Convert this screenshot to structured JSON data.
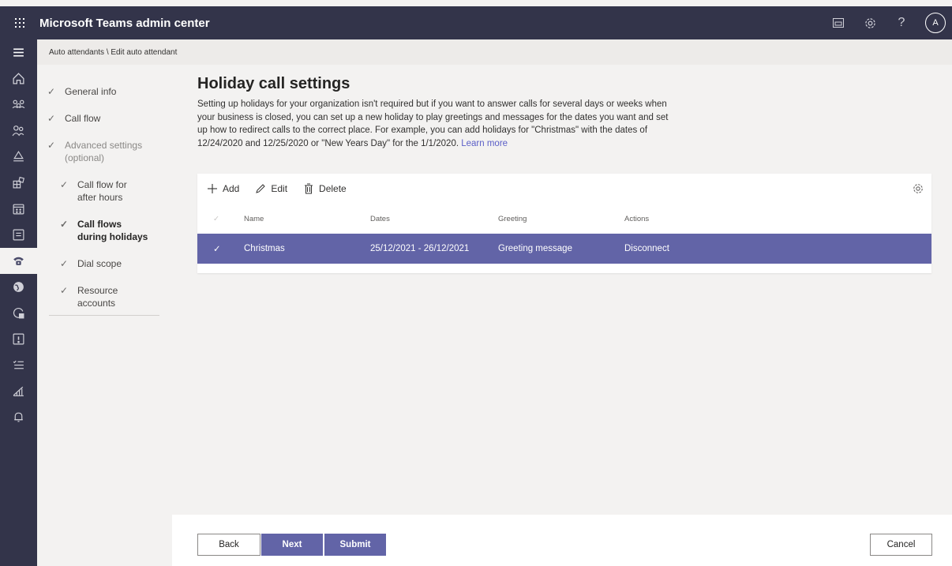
{
  "app": {
    "title": "Microsoft Teams admin center",
    "avatar_initial": "A"
  },
  "top_icons": [
    "dashboard-icon",
    "settings-icon",
    "help-icon"
  ],
  "help_glyph": "?",
  "breadcrumb": "Auto attendants \\ Edit auto attendant",
  "steps": [
    {
      "label": "General info"
    },
    {
      "label": "Call flow"
    },
    {
      "label": "Advanced settings",
      "label2": "(optional)"
    },
    {
      "label": "Call flow for",
      "label2": "after hours"
    },
    {
      "label": "Call flows",
      "label2": "during holidays"
    },
    {
      "label": "Dial scope"
    },
    {
      "label": "Resource",
      "label2": "accounts"
    }
  ],
  "page": {
    "title": "Holiday call settings",
    "description_1": "Setting up holidays for your organization isn't required but if you want to answer calls for several days or weeks when your business is closed, you can set up a new holiday to play greetings and messages for the dates you want and set up how to redirect calls to the correct place. For example, you can add holidays for \"Christmas\" with the dates of 12/24/2020 and 12/25/2020 or \"New Years Day\" for the 1/1/2020.",
    "learn_more": "Learn more"
  },
  "toolbar": {
    "add": "Add",
    "edit": "Edit",
    "delete": "Delete"
  },
  "table": {
    "headers": {
      "name": "Name",
      "dates": "Dates",
      "greeting": "Greeting",
      "actions": "Actions"
    },
    "rows": [
      {
        "name": "Christmas",
        "dates": "25/12/2021 - 26/12/2021",
        "greeting": "Greeting message",
        "actions": "Disconnect"
      }
    ]
  },
  "footer": {
    "back": "Back",
    "next": "Next",
    "submit": "Submit",
    "cancel": "Cancel"
  },
  "colors": {
    "header_bg": "#33344a",
    "accent": "#6264a7",
    "link": "#5b5fc7"
  }
}
